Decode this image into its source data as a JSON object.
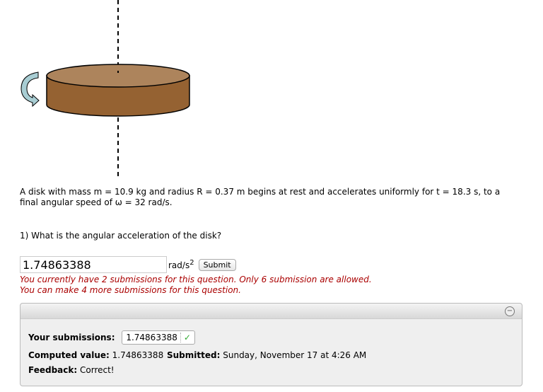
{
  "problem": {
    "text": "A disk with mass m = 10.9 kg and radius R = 0.37 m begins at rest and accelerates uniformly for t = 18.3 s, to a final angular speed of ω = 32 rad/s."
  },
  "question": {
    "text": "1) What is the angular acceleration of the disk?",
    "answer_value": "1.74863388",
    "unit": "rad/s",
    "unit_exp": "2",
    "submit_label": "Submit"
  },
  "notices": [
    "You currently have 2 submissions for this question. Only 6 submission are allowed.",
    "You can make 4 more submissions for this question."
  ],
  "submissions": {
    "label": "Your submissions:",
    "value": "1.74863388",
    "computed_label": "Computed value:",
    "computed_value": "1.74863388",
    "submitted_label": "Submitted:",
    "submitted_value": "Sunday, November 17 at 4:26 AM",
    "feedback_label": "Feedback:",
    "feedback_value": "Correct!",
    "collapse_icon": "minus-circle-icon"
  },
  "colors": {
    "disk_top": "#ad845c",
    "disk_side": "#956232",
    "notice": "#aa0000",
    "check": "#33aa33"
  }
}
